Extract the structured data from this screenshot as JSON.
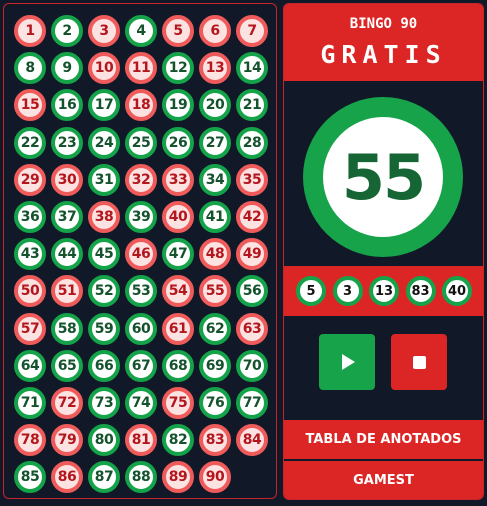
{
  "board": {
    "balls": [
      {
        "n": "1",
        "drawn": true
      },
      {
        "n": "2",
        "drawn": false
      },
      {
        "n": "3",
        "drawn": true
      },
      {
        "n": "4",
        "drawn": false
      },
      {
        "n": "5",
        "drawn": true
      },
      {
        "n": "6",
        "drawn": true
      },
      {
        "n": "7",
        "drawn": true
      },
      {
        "n": "8",
        "drawn": false
      },
      {
        "n": "9",
        "drawn": false
      },
      {
        "n": "10",
        "drawn": true
      },
      {
        "n": "11",
        "drawn": true
      },
      {
        "n": "12",
        "drawn": false
      },
      {
        "n": "13",
        "drawn": true
      },
      {
        "n": "14",
        "drawn": false
      },
      {
        "n": "15",
        "drawn": true
      },
      {
        "n": "16",
        "drawn": false
      },
      {
        "n": "17",
        "drawn": false
      },
      {
        "n": "18",
        "drawn": true
      },
      {
        "n": "19",
        "drawn": false
      },
      {
        "n": "20",
        "drawn": false
      },
      {
        "n": "21",
        "drawn": false
      },
      {
        "n": "22",
        "drawn": false
      },
      {
        "n": "23",
        "drawn": false
      },
      {
        "n": "24",
        "drawn": false
      },
      {
        "n": "25",
        "drawn": false
      },
      {
        "n": "26",
        "drawn": false
      },
      {
        "n": "27",
        "drawn": false
      },
      {
        "n": "28",
        "drawn": false
      },
      {
        "n": "29",
        "drawn": true
      },
      {
        "n": "30",
        "drawn": true
      },
      {
        "n": "31",
        "drawn": false
      },
      {
        "n": "32",
        "drawn": true
      },
      {
        "n": "33",
        "drawn": true
      },
      {
        "n": "34",
        "drawn": false
      },
      {
        "n": "35",
        "drawn": true
      },
      {
        "n": "36",
        "drawn": false
      },
      {
        "n": "37",
        "drawn": false
      },
      {
        "n": "38",
        "drawn": true
      },
      {
        "n": "39",
        "drawn": false
      },
      {
        "n": "40",
        "drawn": true
      },
      {
        "n": "41",
        "drawn": false
      },
      {
        "n": "42",
        "drawn": true
      },
      {
        "n": "43",
        "drawn": false
      },
      {
        "n": "44",
        "drawn": false
      },
      {
        "n": "45",
        "drawn": false
      },
      {
        "n": "46",
        "drawn": true
      },
      {
        "n": "47",
        "drawn": false
      },
      {
        "n": "48",
        "drawn": true
      },
      {
        "n": "49",
        "drawn": true
      },
      {
        "n": "50",
        "drawn": true
      },
      {
        "n": "51",
        "drawn": true
      },
      {
        "n": "52",
        "drawn": false
      },
      {
        "n": "53",
        "drawn": false
      },
      {
        "n": "54",
        "drawn": true
      },
      {
        "n": "55",
        "drawn": true
      },
      {
        "n": "56",
        "drawn": false
      },
      {
        "n": "57",
        "drawn": true
      },
      {
        "n": "58",
        "drawn": false
      },
      {
        "n": "59",
        "drawn": false
      },
      {
        "n": "60",
        "drawn": false
      },
      {
        "n": "61",
        "drawn": true
      },
      {
        "n": "62",
        "drawn": false
      },
      {
        "n": "63",
        "drawn": true
      },
      {
        "n": "64",
        "drawn": false
      },
      {
        "n": "65",
        "drawn": false
      },
      {
        "n": "66",
        "drawn": false
      },
      {
        "n": "67",
        "drawn": false
      },
      {
        "n": "68",
        "drawn": false
      },
      {
        "n": "69",
        "drawn": false
      },
      {
        "n": "70",
        "drawn": false
      },
      {
        "n": "71",
        "drawn": false
      },
      {
        "n": "72",
        "drawn": true
      },
      {
        "n": "73",
        "drawn": false
      },
      {
        "n": "74",
        "drawn": false
      },
      {
        "n": "75",
        "drawn": true
      },
      {
        "n": "76",
        "drawn": false
      },
      {
        "n": "77",
        "drawn": false
      },
      {
        "n": "78",
        "drawn": true
      },
      {
        "n": "79",
        "drawn": true
      },
      {
        "n": "80",
        "drawn": false
      },
      {
        "n": "81",
        "drawn": true
      },
      {
        "n": "82",
        "drawn": false
      },
      {
        "n": "83",
        "drawn": true
      },
      {
        "n": "84",
        "drawn": true
      },
      {
        "n": "85",
        "drawn": false
      },
      {
        "n": "86",
        "drawn": true
      },
      {
        "n": "87",
        "drawn": false
      },
      {
        "n": "88",
        "drawn": false
      },
      {
        "n": "89",
        "drawn": true
      },
      {
        "n": "90",
        "drawn": true
      }
    ]
  },
  "header": {
    "subtitle": "BINGO 90",
    "title": "GRATIS"
  },
  "current_ball": "55",
  "history": [
    "5",
    "3",
    "13",
    "83",
    "40"
  ],
  "controls": {
    "play_icon": "play-icon",
    "stop_icon": "stop-icon"
  },
  "buttons": {
    "tabla": "TABLA DE ANOTADOS",
    "gamest": "GAMEST"
  },
  "colors": {
    "red": "#dc2626",
    "green": "#16a34a",
    "background": "#111827"
  }
}
